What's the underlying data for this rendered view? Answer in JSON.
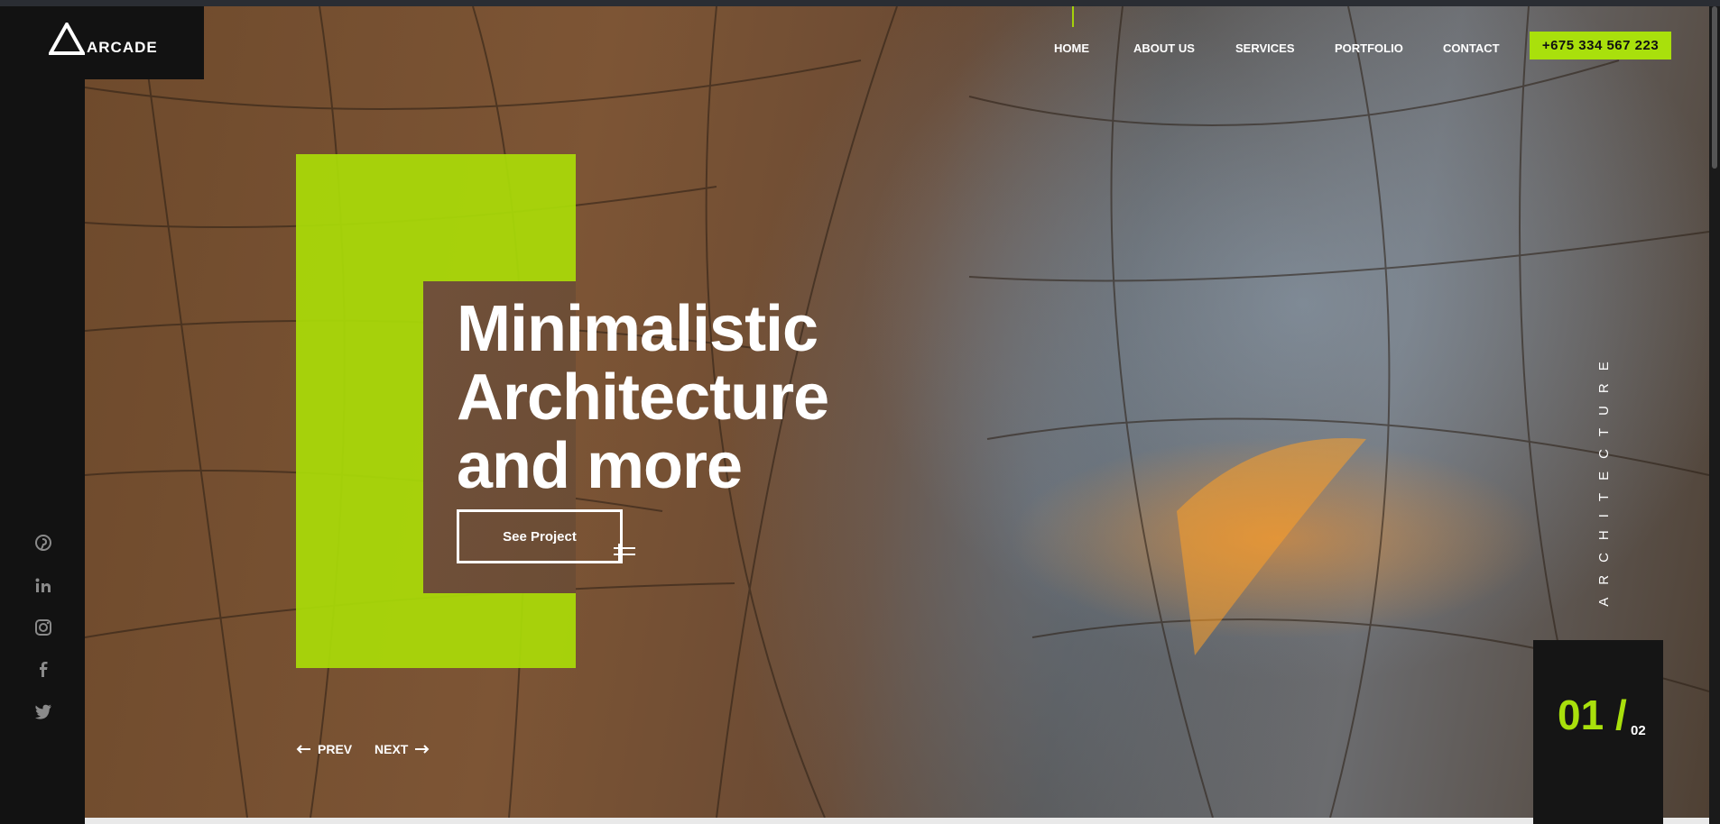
{
  "brand": {
    "logo_text": "ARCADE",
    "accent_color": "#a9e00c"
  },
  "nav": {
    "items": [
      {
        "label": "HOME",
        "active": true
      },
      {
        "label": "ABOUT US",
        "active": false
      },
      {
        "label": "SERVICES",
        "active": false
      },
      {
        "label": "PORTFOLIO",
        "active": false
      },
      {
        "label": "CONTACT",
        "active": false
      }
    ],
    "phone": "+675 334 567 223"
  },
  "hero": {
    "headline_lines": [
      "Minimalistic",
      "Architecture",
      "and more"
    ],
    "cta_label": "See Project",
    "vertical_label": "ARCHITECTURE"
  },
  "slider": {
    "prev_label": "PREV",
    "next_label": "NEXT",
    "current": "01 /",
    "total": "02"
  },
  "social": {
    "icons": [
      "pinterest-icon",
      "linkedin-icon",
      "instagram-icon",
      "facebook-icon",
      "twitter-icon"
    ]
  }
}
